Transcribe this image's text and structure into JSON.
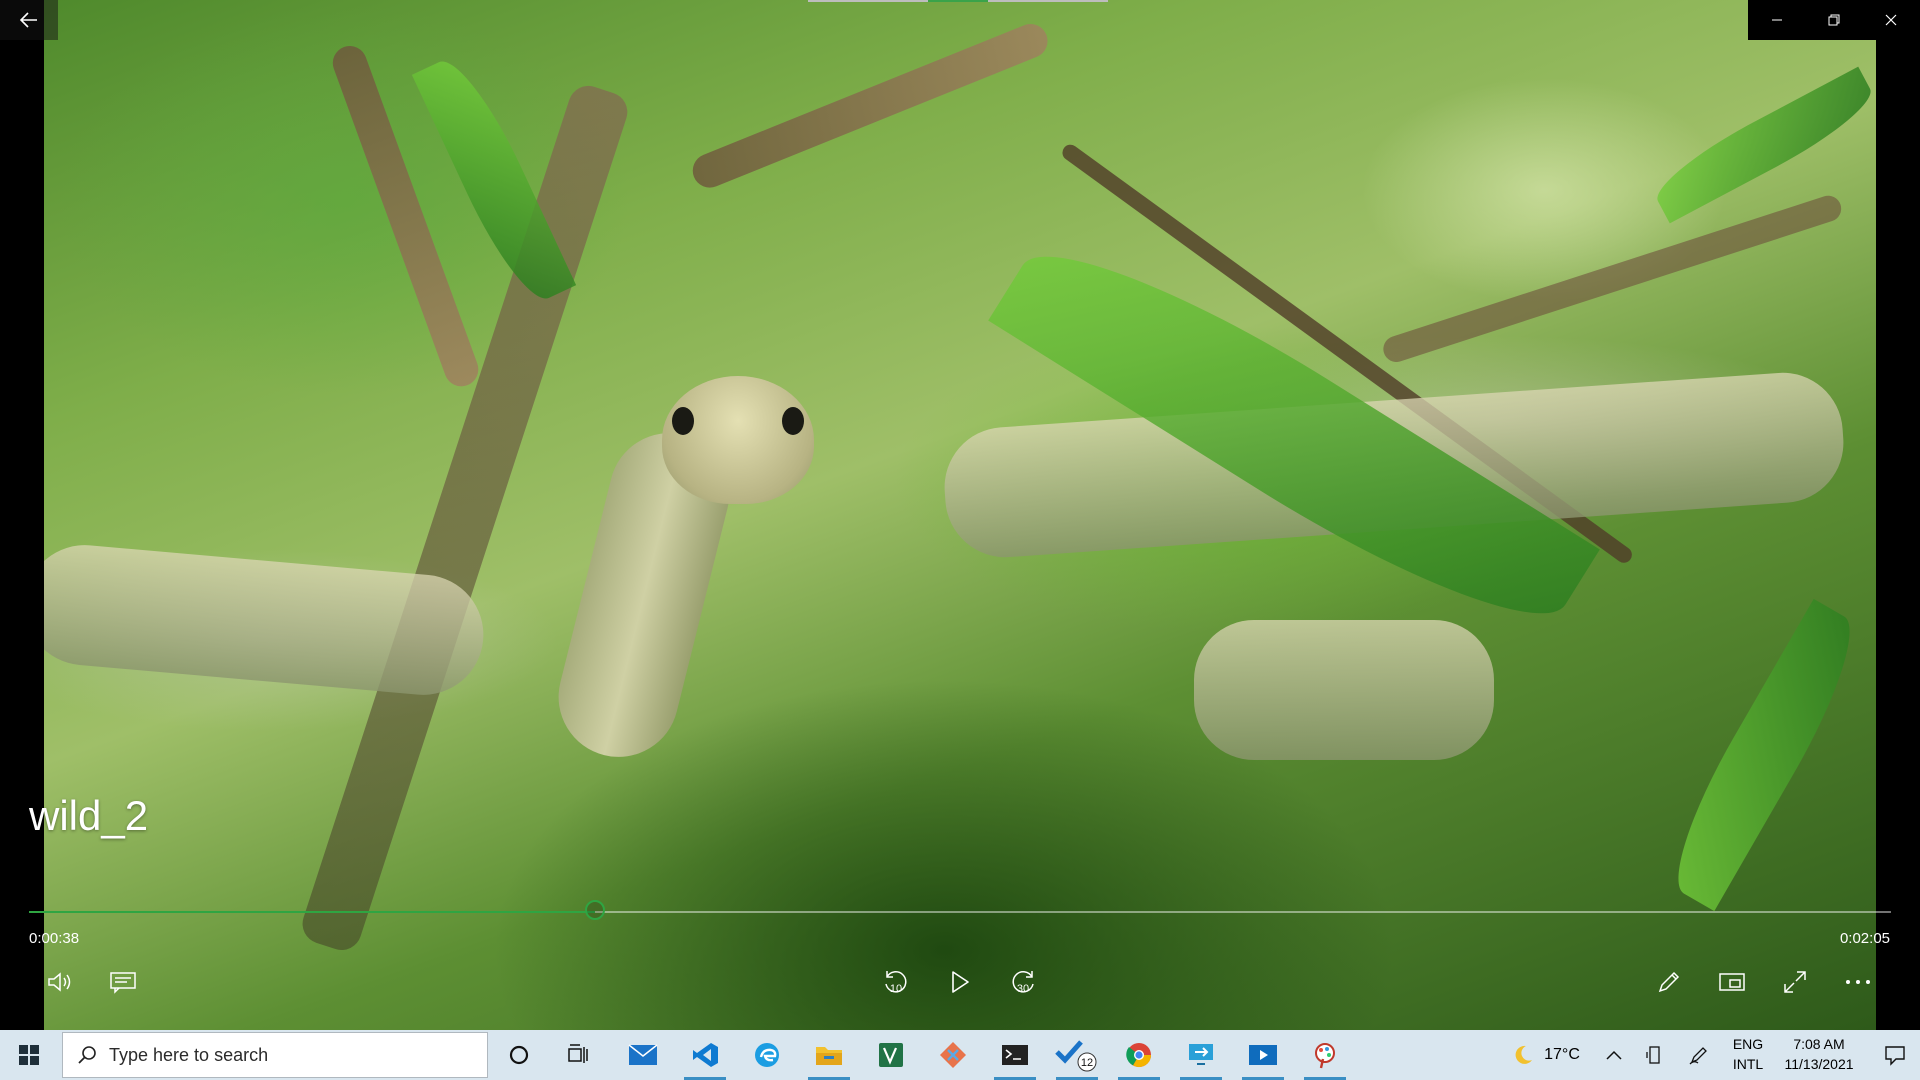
{
  "video": {
    "title": "wild_2",
    "current_time": "0:00:38",
    "total_time": "0:02:05",
    "progress": 0.304
  },
  "window_controls": {
    "back": "back-arrow-icon",
    "minimize": "minimize-icon",
    "restore": "restore-icon",
    "close": "close-icon"
  },
  "controls": {
    "skip_back_label": "10",
    "skip_forward_label": "30"
  },
  "taskbar": {
    "search_placeholder": "Type here to search",
    "badge_count": "12",
    "temperature": "17°C",
    "language_top": "ENG",
    "language_bottom": "INTL",
    "time": "7:08 AM",
    "date": "11/13/2021"
  },
  "colors": {
    "accent": "#2fa542",
    "taskbar_bg": "#d9e6ef"
  }
}
